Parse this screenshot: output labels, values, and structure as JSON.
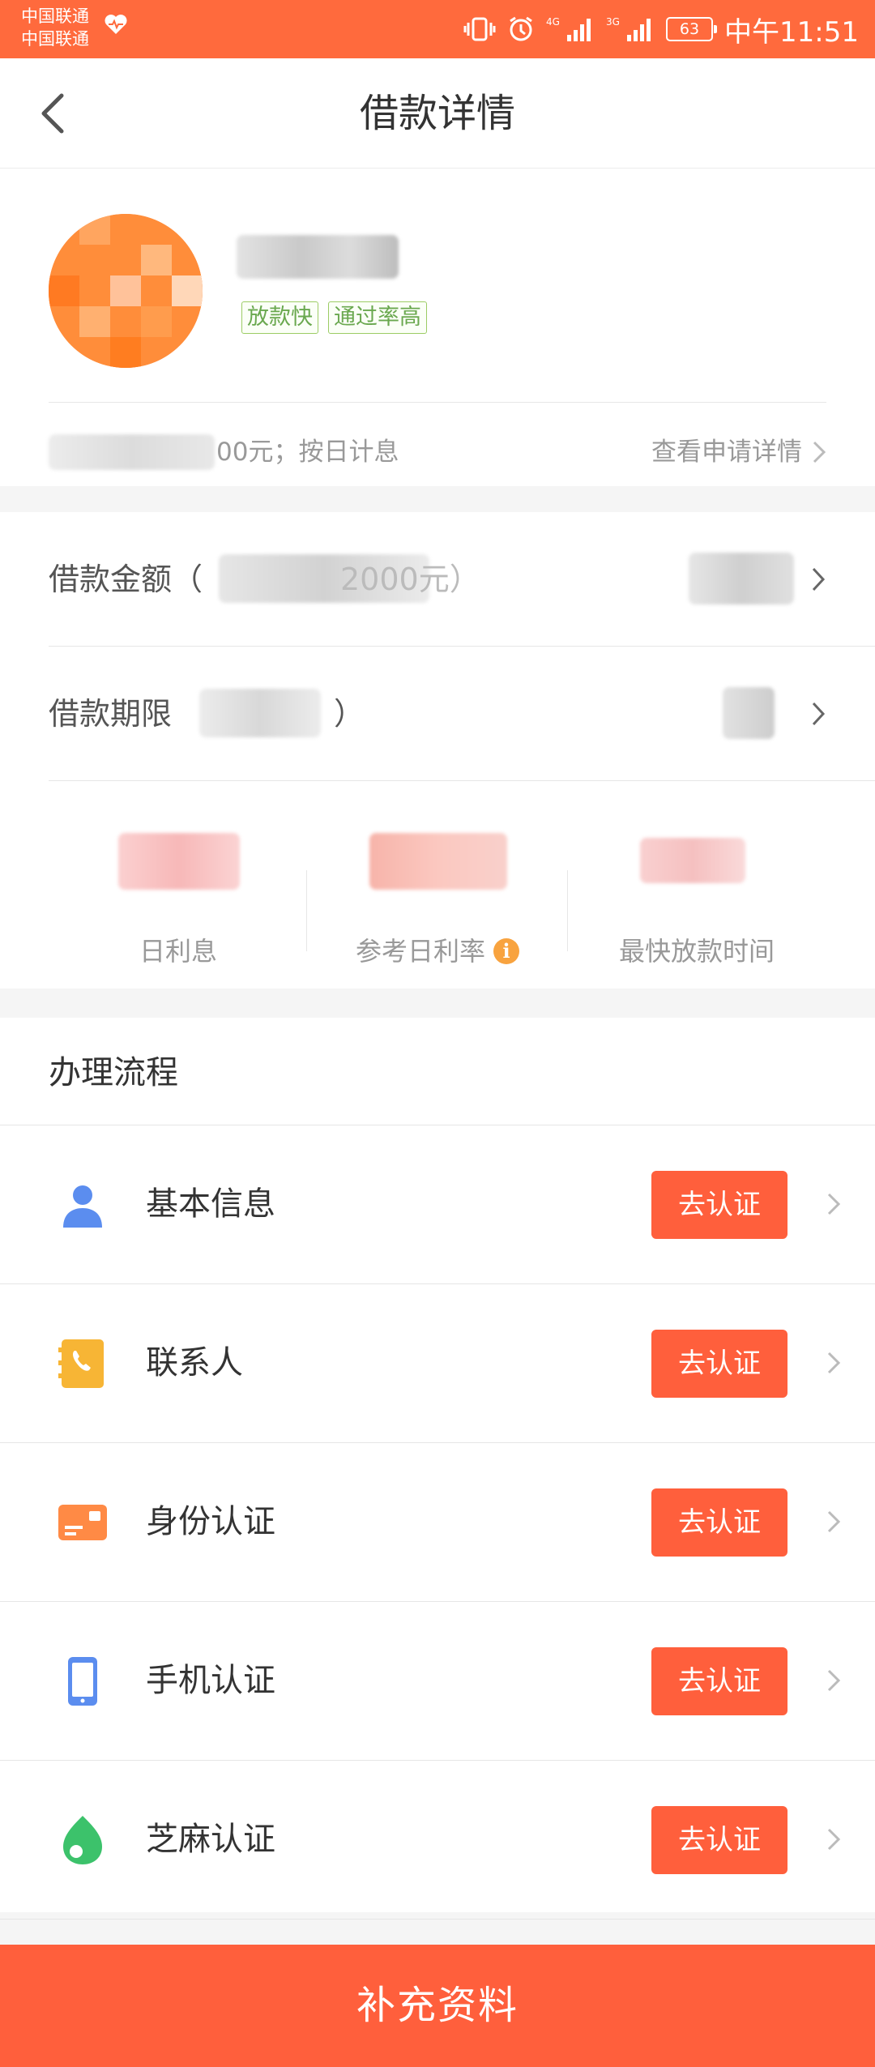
{
  "status_bar": {
    "carrier_1": "中国联通",
    "carrier_2": "中国联通",
    "network_1": "4G",
    "network_2": "3G",
    "battery": "63",
    "time": "中午11:51",
    "icons": [
      "heart-rate-icon",
      "vibrate-icon",
      "alarm-icon",
      "signal-icon",
      "battery-icon"
    ]
  },
  "nav": {
    "title": "借款详情",
    "back_icon": "back-chevron-icon"
  },
  "product": {
    "tags": [
      "放款快",
      "通过率高"
    ],
    "amount_range_suffix": "00元；按日计息",
    "apply_detail_link": "查看申请详情"
  },
  "loan_params": {
    "amount_label": "借款金额（",
    "amount_partial": "2000元）",
    "term_label": "借款期限",
    "term_paren_close": "）"
  },
  "stats": {
    "daily_interest_label": "日利息",
    "ref_daily_rate_label": "参考日利率",
    "fastest_loan_time_label": "最快放款时间"
  },
  "process": {
    "title": "办理流程",
    "steps": [
      {
        "label": "基本信息",
        "button": "去认证",
        "icon": "person-icon",
        "color": "#5b8def"
      },
      {
        "label": "联系人",
        "button": "去认证",
        "icon": "phone-book-icon",
        "color": "#f7b535"
      },
      {
        "label": "身份认证",
        "button": "去认证",
        "icon": "id-card-icon",
        "color": "#ff8a45"
      },
      {
        "label": "手机认证",
        "button": "去认证",
        "icon": "mobile-phone-icon",
        "color": "#5b8def"
      },
      {
        "label": "芝麻认证",
        "button": "去认证",
        "icon": "sesame-icon",
        "color": "#3cc26b"
      }
    ]
  },
  "submit": {
    "label": "补充资料"
  },
  "colors": {
    "accent": "#ff5f3c",
    "status_bar": "#ff6a3d",
    "tag_green": "#6aa84f"
  }
}
